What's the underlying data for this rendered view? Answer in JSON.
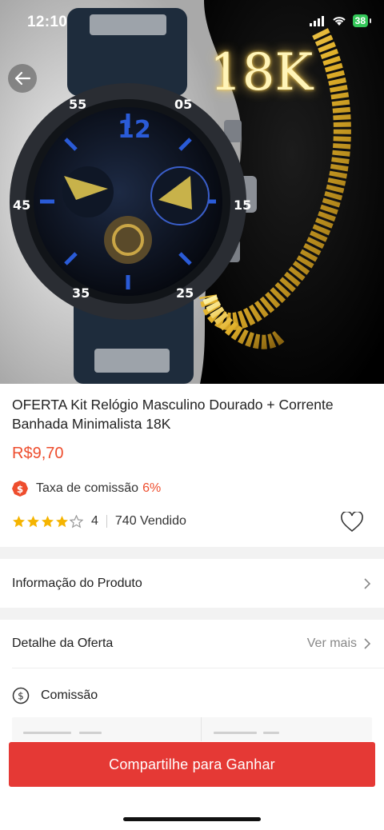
{
  "status_bar": {
    "time": "12:10",
    "battery": "38"
  },
  "hero": {
    "badge_text": "18K"
  },
  "product": {
    "title": "OFERTA Kit Relógio Masculino Dourado + Corrente Banhada Minimalista 18K",
    "price": "R$9,70",
    "commission_label": "Taxa de comissão",
    "commission_rate": "6%",
    "rating": 4,
    "rating_text": "4",
    "sold_text": "740 Vendido"
  },
  "sections": {
    "product_info": "Informação do Produto",
    "offer_detail": "Detalhe da Oferta",
    "see_more": "Ver mais",
    "commission": "Comissão"
  },
  "cta": {
    "share_label": "Compartilhe para Ganhar"
  },
  "colors": {
    "accent": "#ee4d2d",
    "button": "#e53935",
    "star": "#f5b400"
  }
}
